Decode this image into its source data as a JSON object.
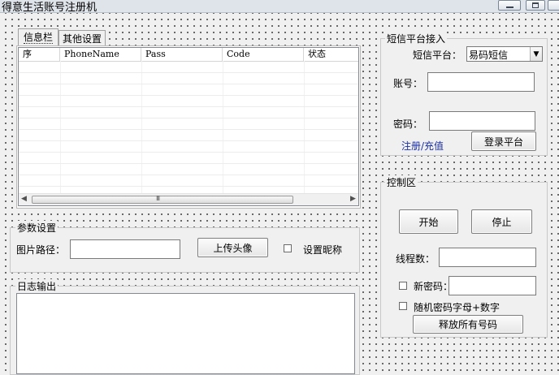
{
  "window": {
    "title": "得意生活账号注册机"
  },
  "tabs": [
    {
      "label": "信息栏",
      "active": true
    },
    {
      "label": "其他设置",
      "active": false
    }
  ],
  "table": {
    "columns": [
      "序",
      "PhoneName",
      "Pass",
      "Code",
      "状态"
    ],
    "rows": []
  },
  "scrollbar": {
    "thumb_grip": "III"
  },
  "params": {
    "title": "参数设置",
    "path_label": "图片路径：",
    "path_value": "",
    "upload_label": "上传头像",
    "nickname_label": "设置昵称"
  },
  "log": {
    "title": "日志输出",
    "content": ""
  },
  "sms": {
    "title": "短信平台接入",
    "platform_label": "短信平台：",
    "platform_value": "易码短信",
    "account_label": "账号：",
    "account_value": "",
    "password_label": "密码：",
    "password_value": "",
    "register_link": "注册/充值",
    "login_label": "登录平台"
  },
  "control": {
    "title": "控制区",
    "start_label": "开始",
    "stop_label": "停止",
    "threads_label": "线程数：",
    "threads_value": "",
    "new_password_label": "新密码：",
    "new_password_value": "",
    "random_password_label": "随机密码字母+数字",
    "release_label": "释放所有号码"
  }
}
